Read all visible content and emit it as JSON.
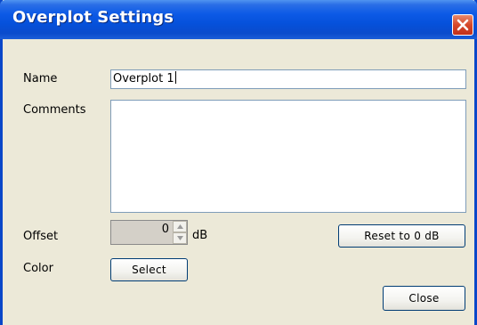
{
  "window": {
    "title": "Overplot Settings",
    "close_icon": "close-icon"
  },
  "form": {
    "name_label": "Name",
    "name_value": "Overplot 1",
    "comments_label": "Comments",
    "comments_value": "",
    "offset_label": "Offset",
    "offset_value": "0",
    "offset_unit": "dB",
    "color_label": "Color"
  },
  "buttons": {
    "reset": "Reset to 0 dB",
    "select": "Select",
    "close": "Close"
  },
  "colors": {
    "titlebar": "#0551db",
    "window_bg": "#ece9d8",
    "close_button": "#d5482a"
  }
}
